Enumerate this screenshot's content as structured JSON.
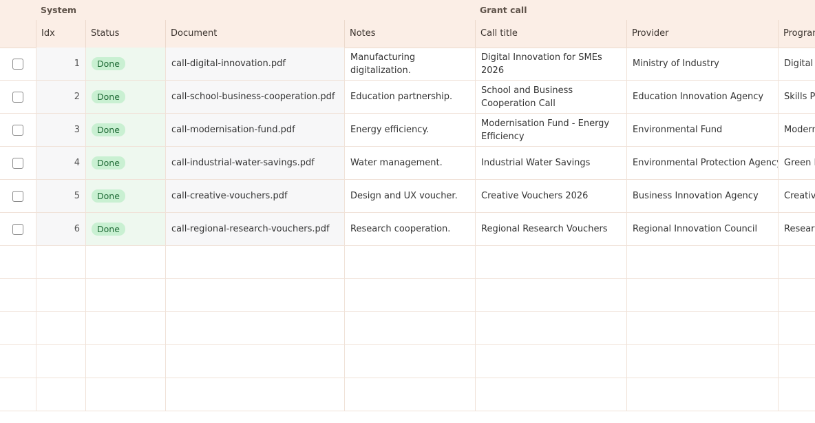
{
  "groups": [
    {
      "label": ""
    },
    {
      "label": "System"
    },
    {
      "label": "Grant call"
    }
  ],
  "columns": [
    "",
    "Idx",
    "Status",
    "Document",
    "Notes",
    "Call title",
    "Provider",
    "Program"
  ],
  "rows": [
    {
      "idx": "1",
      "status": "Done",
      "document": "call-digital-innovation.pdf",
      "notes": "Manufacturing digitalization.",
      "call_title": "Digital Innovation for SMEs 2026",
      "provider": "Ministry of Industry",
      "program": "Digital I"
    },
    {
      "idx": "2",
      "status": "Done",
      "document": "call-school-business-cooperation.pdf",
      "notes": "Education partnership.",
      "call_title": "School and Business Cooperation Call",
      "provider": "Education Innovation Agency",
      "program": "Skills Pa"
    },
    {
      "idx": "3",
      "status": "Done",
      "document": "call-modernisation-fund.pdf",
      "notes": "Energy efficiency.",
      "call_title": "Modernisation Fund - Energy Efficiency",
      "provider": "Environmental Fund",
      "program": "Modern"
    },
    {
      "idx": "4",
      "status": "Done",
      "document": "call-industrial-water-savings.pdf",
      "notes": "Water management.",
      "call_title": "Industrial Water Savings",
      "provider": "Environmental Protection Agency",
      "program": "Green I"
    },
    {
      "idx": "5",
      "status": "Done",
      "document": "call-creative-vouchers.pdf",
      "notes": "Design and UX voucher.",
      "call_title": "Creative Vouchers 2026",
      "provider": "Business Innovation Agency",
      "program": "Creative"
    },
    {
      "idx": "6",
      "status": "Done",
      "document": "call-regional-research-vouchers.pdf",
      "notes": "Research cooperation.",
      "call_title": "Regional Research Vouchers",
      "provider": "Regional Innovation Council",
      "program": "Researc"
    }
  ],
  "colors": {
    "header_bg": "#fbeee6",
    "status_done_bg": "#c9f0d2",
    "status_done_text": "#1f6b36"
  }
}
